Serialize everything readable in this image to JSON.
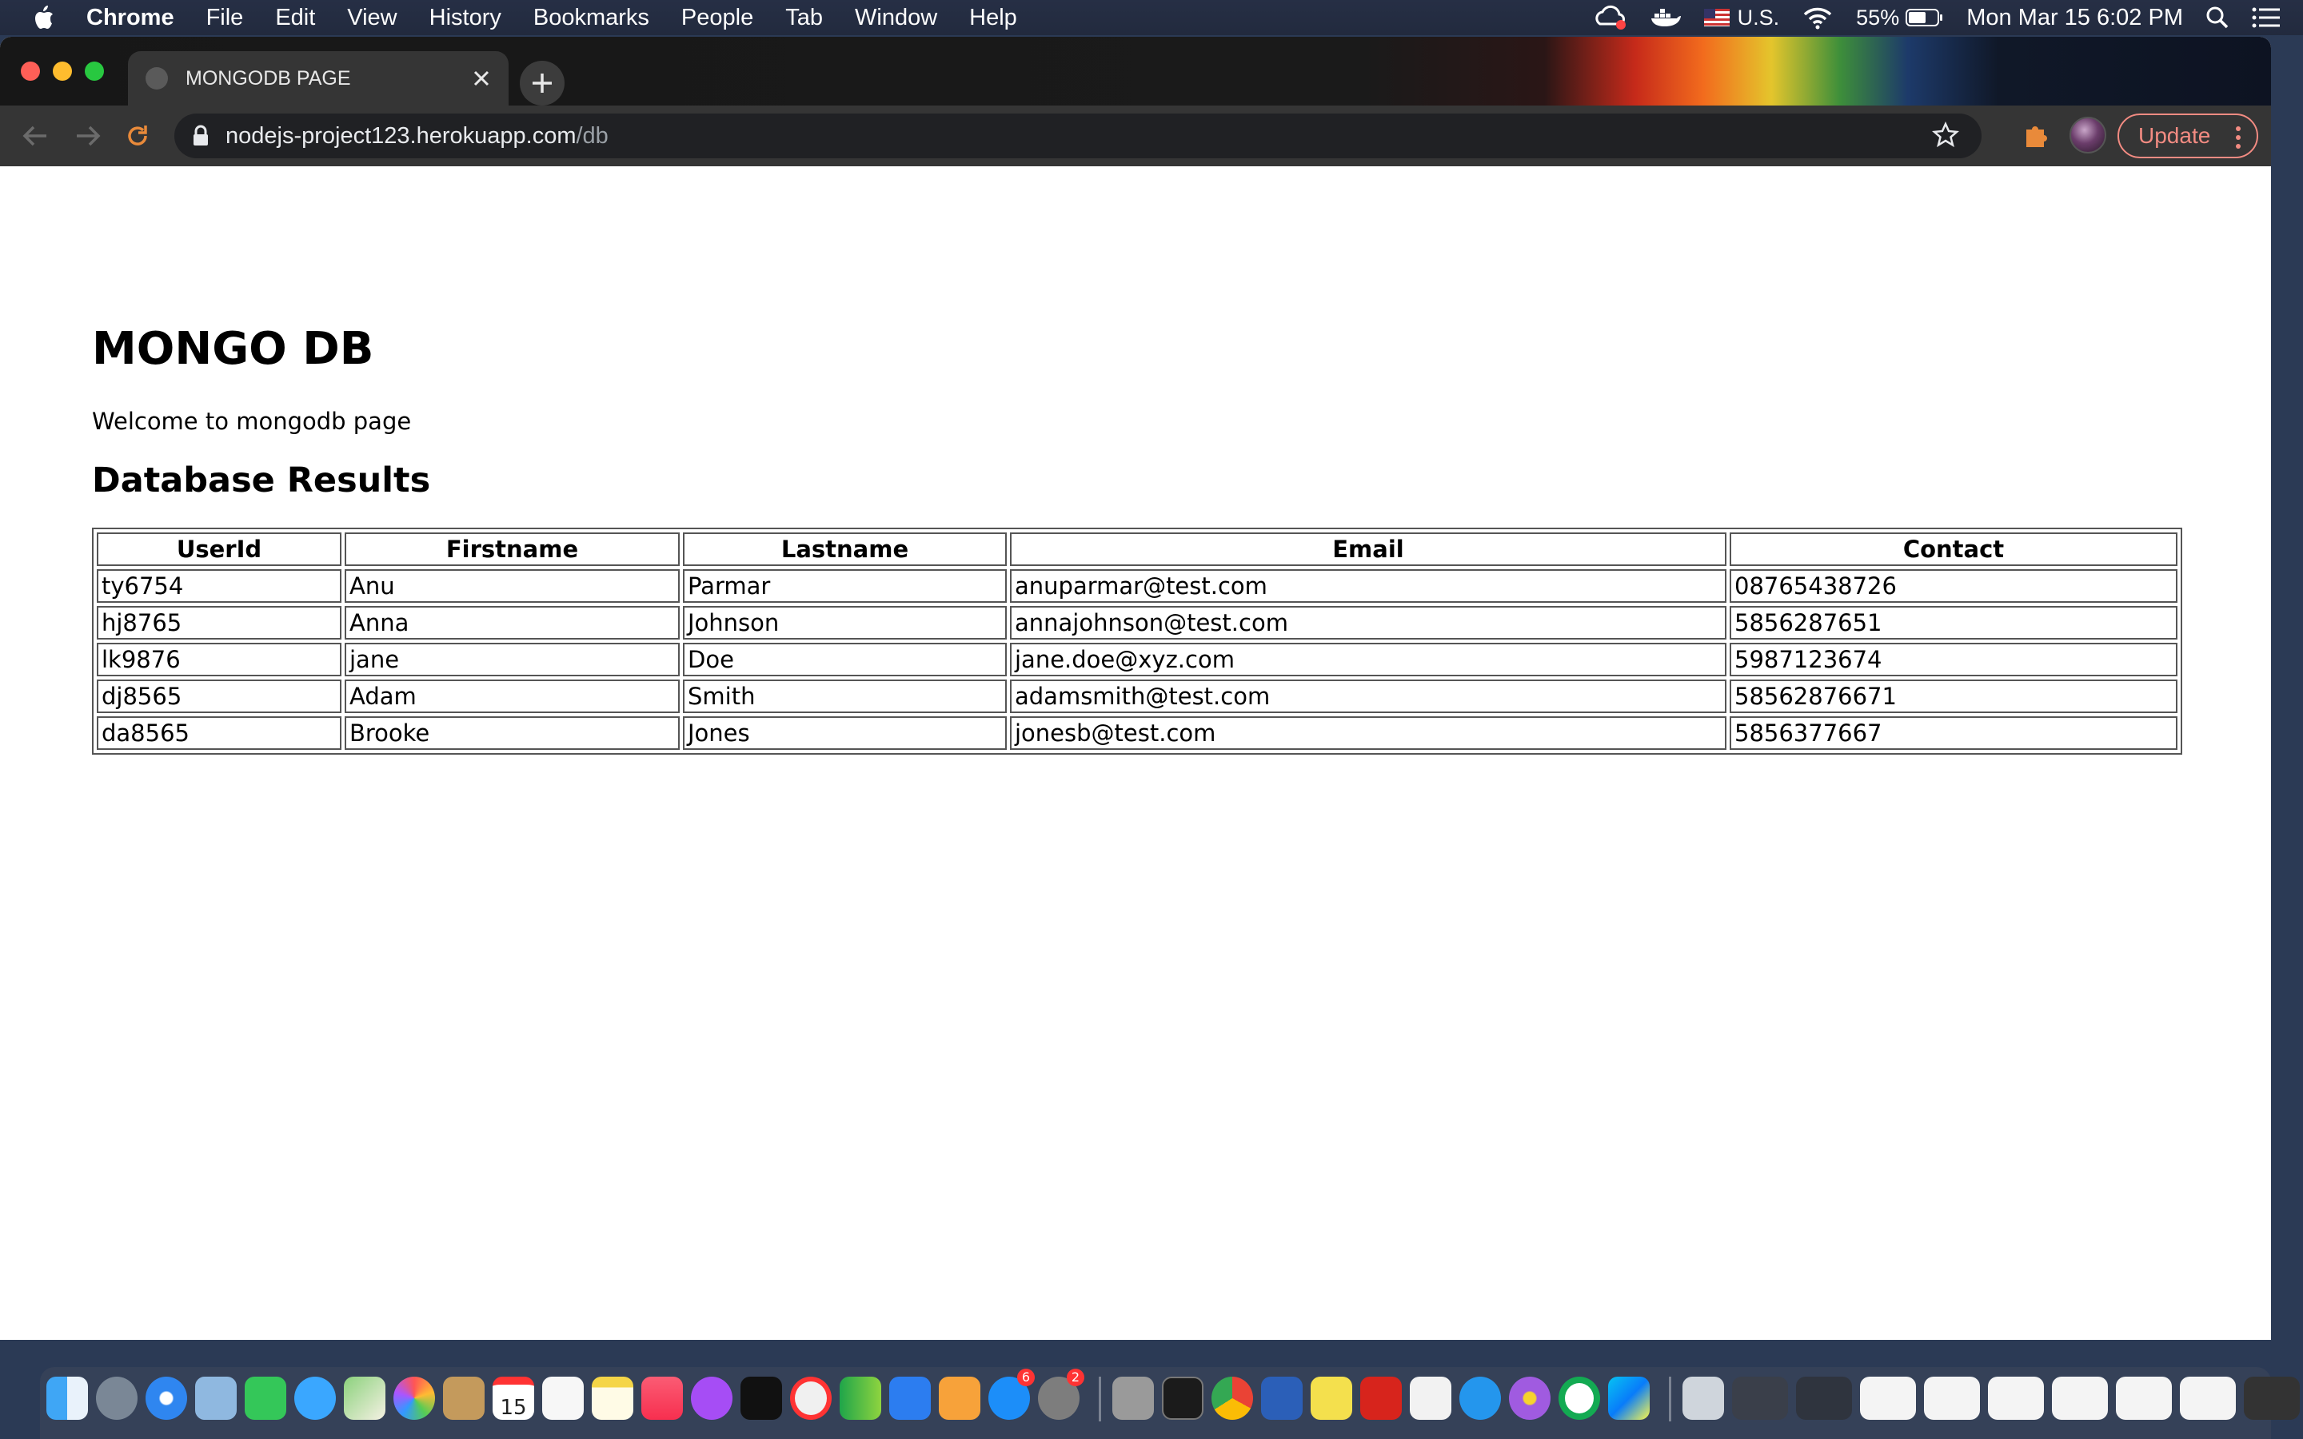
{
  "menubar": {
    "app": "Chrome",
    "items": [
      "File",
      "Edit",
      "View",
      "History",
      "Bookmarks",
      "People",
      "Tab",
      "Window",
      "Help"
    ],
    "input_source": "U.S.",
    "battery": "55%",
    "datetime": "Mon Mar 15  6:02 PM"
  },
  "browser": {
    "tab_title": "MONGODB PAGE",
    "url_host": "nodejs-project123.herokuapp.com",
    "url_path": "/db",
    "update_label": "Update"
  },
  "page": {
    "heading": "MONGO DB",
    "welcome": "Welcome to mongodb page",
    "subheading": "Database Results",
    "table": {
      "headers": [
        "UserId",
        "Firstname",
        "Lastname",
        "Email",
        "Contact"
      ],
      "rows": [
        [
          "ty6754",
          "Anu",
          "Parmar",
          "anuparmar@test.com",
          "08765438726"
        ],
        [
          "hj8765",
          "Anna",
          "Johnson",
          "annajohnson@test.com",
          "5856287651"
        ],
        [
          "lk9876",
          "jane",
          "Doe",
          "jane.doe@xyz.com",
          "5987123674"
        ],
        [
          "dj8565",
          "Adam",
          "Smith",
          "adamsmith@test.com",
          "58562876671"
        ],
        [
          "da8565",
          "Brooke",
          "Jones",
          "jonesb@test.com",
          "5856377667"
        ]
      ]
    }
  },
  "dock": {
    "calendar_day": "15",
    "appstore_badge": "6",
    "settings_badge": "2",
    "icons": [
      "finder-icon",
      "launchpad-icon",
      "safari-icon",
      "mail-icon",
      "facetime-icon",
      "messages-icon",
      "maps-icon",
      "photos-icon",
      "contacts-icon",
      "calendar-icon",
      "reminders-icon",
      "notes-icon",
      "music-icon",
      "podcasts-icon",
      "tv-icon",
      "news-icon",
      "numbers-icon",
      "keynote-icon",
      "pages-icon",
      "appstore-icon",
      "settings-icon",
      "keychain-icon",
      "terminal-icon",
      "chrome-icon",
      "word-icon",
      "stickies-icon",
      "acrobat-icon",
      "textedit-icon",
      "docker-icon",
      "flower-icon",
      "mongodb-compass-icon",
      "webstorm-icon",
      "downloads-icon",
      "trash-icon"
    ]
  },
  "colors": {
    "menubar_bg": "#232b40",
    "tab_bg": "#353535",
    "omnibox_bg": "#202124",
    "update_accent": "#f28b82"
  }
}
